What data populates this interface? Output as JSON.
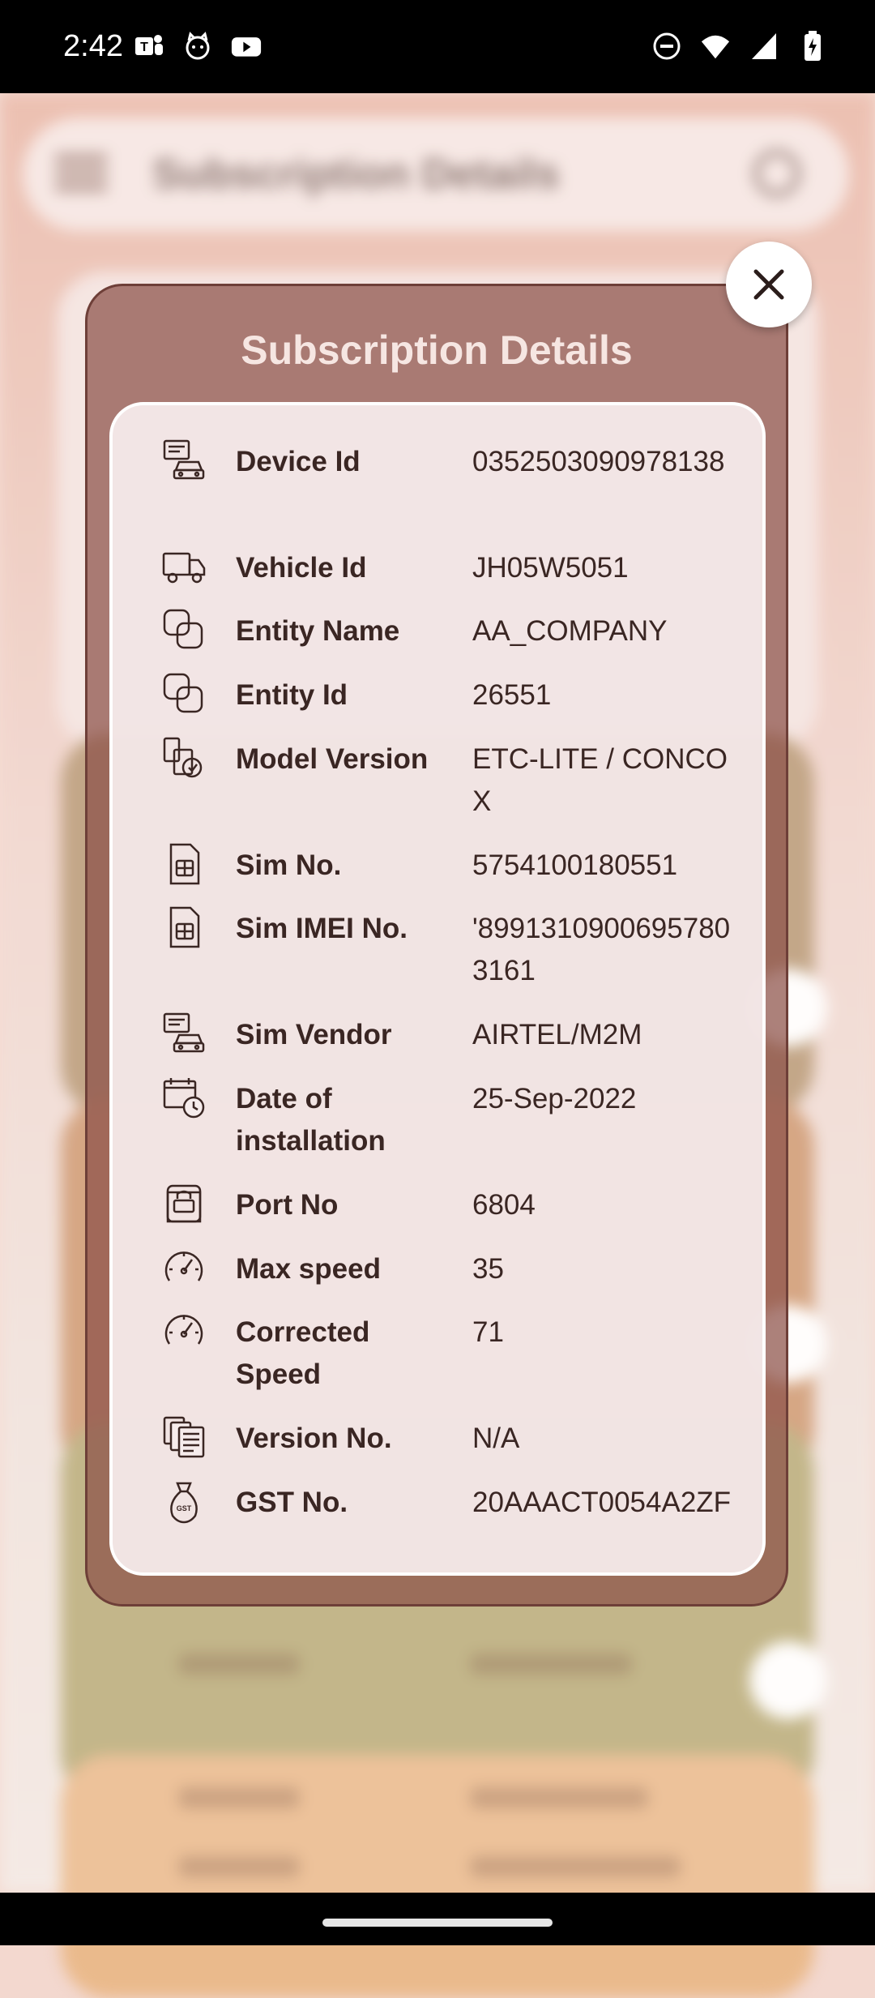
{
  "status_bar": {
    "time": "2:42",
    "left_icons": [
      "teams-icon",
      "cat-face-icon",
      "youtube-icon"
    ],
    "right_icons": [
      "do-not-disturb-icon",
      "wifi-icon",
      "signal-icon",
      "battery-charging-icon"
    ]
  },
  "background": {
    "search_title": "Subscription Details"
  },
  "modal": {
    "title": "Subscription Details",
    "close_icon": "close-icon",
    "rows": [
      {
        "icon": "device-car-icon",
        "label": "Device Id",
        "value": "0352503090978138"
      },
      {
        "icon": "truck-icon",
        "label": "Vehicle Id",
        "value": "JH05W5051"
      },
      {
        "icon": "entity-squares-icon",
        "label": "Entity Name",
        "value": "AA_COMPANY"
      },
      {
        "icon": "entity-squares-icon",
        "label": "Entity Id",
        "value": "26551"
      },
      {
        "icon": "model-docs-icon",
        "label": "Model Version",
        "value": "ETC-LITE / CONCOX"
      },
      {
        "icon": "sim-card-icon",
        "label": "Sim No.",
        "value": "5754100180551"
      },
      {
        "icon": "sim-card-icon",
        "label": "Sim IMEI No.",
        "value": "'89913109006957803161"
      },
      {
        "icon": "device-car-icon",
        "label": "Sim Vendor",
        "value": "AIRTEL/M2M"
      },
      {
        "icon": "calendar-clock-icon",
        "label": "Date of installation",
        "value": "25-Sep-2022"
      },
      {
        "icon": "port-bag-icon",
        "label": "Port No",
        "value": "6804"
      },
      {
        "icon": "speedometer-icon",
        "label": "Max speed",
        "value": "35"
      },
      {
        "icon": "speedometer-icon",
        "label": "Corrected Speed",
        "value": "71"
      },
      {
        "icon": "documents-stack-icon",
        "label": "Version No.",
        "value": "N/A"
      },
      {
        "icon": "gst-bag-icon",
        "label": "GST No.",
        "value": "20AAACT0054A2ZF"
      }
    ]
  }
}
